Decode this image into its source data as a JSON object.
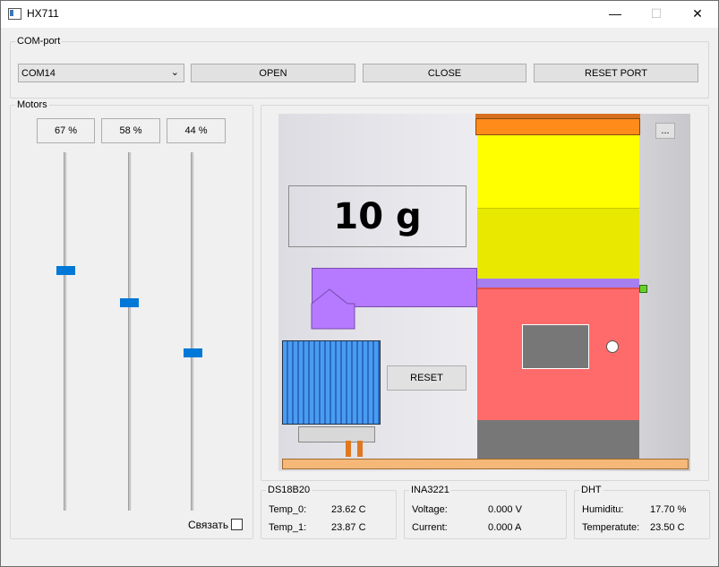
{
  "window": {
    "title": "HX711",
    "minimize": "—",
    "maximize": "☐",
    "close": "✕"
  },
  "com_port": {
    "group_label": "COM-port",
    "selected_port": "COM14",
    "open_label": "OPEN",
    "close_label": "CLOSE",
    "reset_port_label": "RESET PORT"
  },
  "motors": {
    "group_label": "Motors",
    "items": [
      {
        "percent_label": "67 %",
        "level": 0.67
      },
      {
        "percent_label": "58 %",
        "level": 0.58
      },
      {
        "percent_label": "44 %",
        "level": 0.44
      }
    ],
    "link_label": "Связать",
    "link_checked": false
  },
  "scene": {
    "weight_label": "10 g",
    "reset_label": "RESET",
    "more_label": "..."
  },
  "ds18b20": {
    "group_label": "DS18B20",
    "rows": [
      {
        "label": "Temp_0:",
        "value": "23.62 C"
      },
      {
        "label": "Temp_1:",
        "value": "23.87 C"
      }
    ]
  },
  "ina3221": {
    "group_label": "INA3221",
    "rows": [
      {
        "label": "Voltage:",
        "value": "0.000 V"
      },
      {
        "label": "Current:",
        "value": "0.000 A"
      }
    ]
  },
  "dht": {
    "group_label": "DHT",
    "rows": [
      {
        "label": "Humiditu:",
        "value": "17.70 %"
      },
      {
        "label": "Temperatute:",
        "value": "23.50 C"
      }
    ]
  },
  "colors": {
    "accent": "#0078d7",
    "hopper_orange": "#ff8c1a",
    "hopper_yellow": "#ffff00",
    "body_red": "#ff6b6b",
    "pipe_purple": "#b57aff",
    "fan_blue": "#3c8ce6",
    "base_tan": "#f5b878"
  }
}
